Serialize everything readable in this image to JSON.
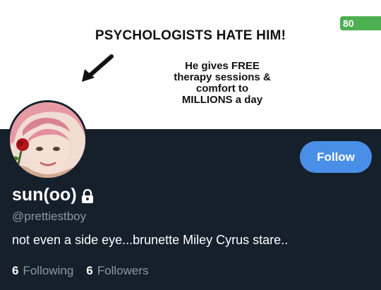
{
  "status": {
    "battery": "80"
  },
  "banner": {
    "headline": "PSYCHOLOGISTS HATE HIM!",
    "subtext_lines": [
      "He gives FREE",
      "therapy sessions &",
      "comfort to",
      "MILLIONS a day"
    ]
  },
  "profile": {
    "display_name": "sun(oo)",
    "handle": "@prettiestboy",
    "bio": "not even a side eye...brunette Miley Cyrus stare..",
    "follow_label": "Follow",
    "following_count": "6",
    "following_label": "Following",
    "followers_count": "6",
    "followers_label": "Followers"
  },
  "colors": {
    "background": "#15202b",
    "accent": "#4a8fe7",
    "secondary_text": "#8899a6",
    "battery_badge": "#4caf50"
  },
  "icons": {
    "lock": "lock-icon",
    "arrow": "arrow-icon"
  }
}
